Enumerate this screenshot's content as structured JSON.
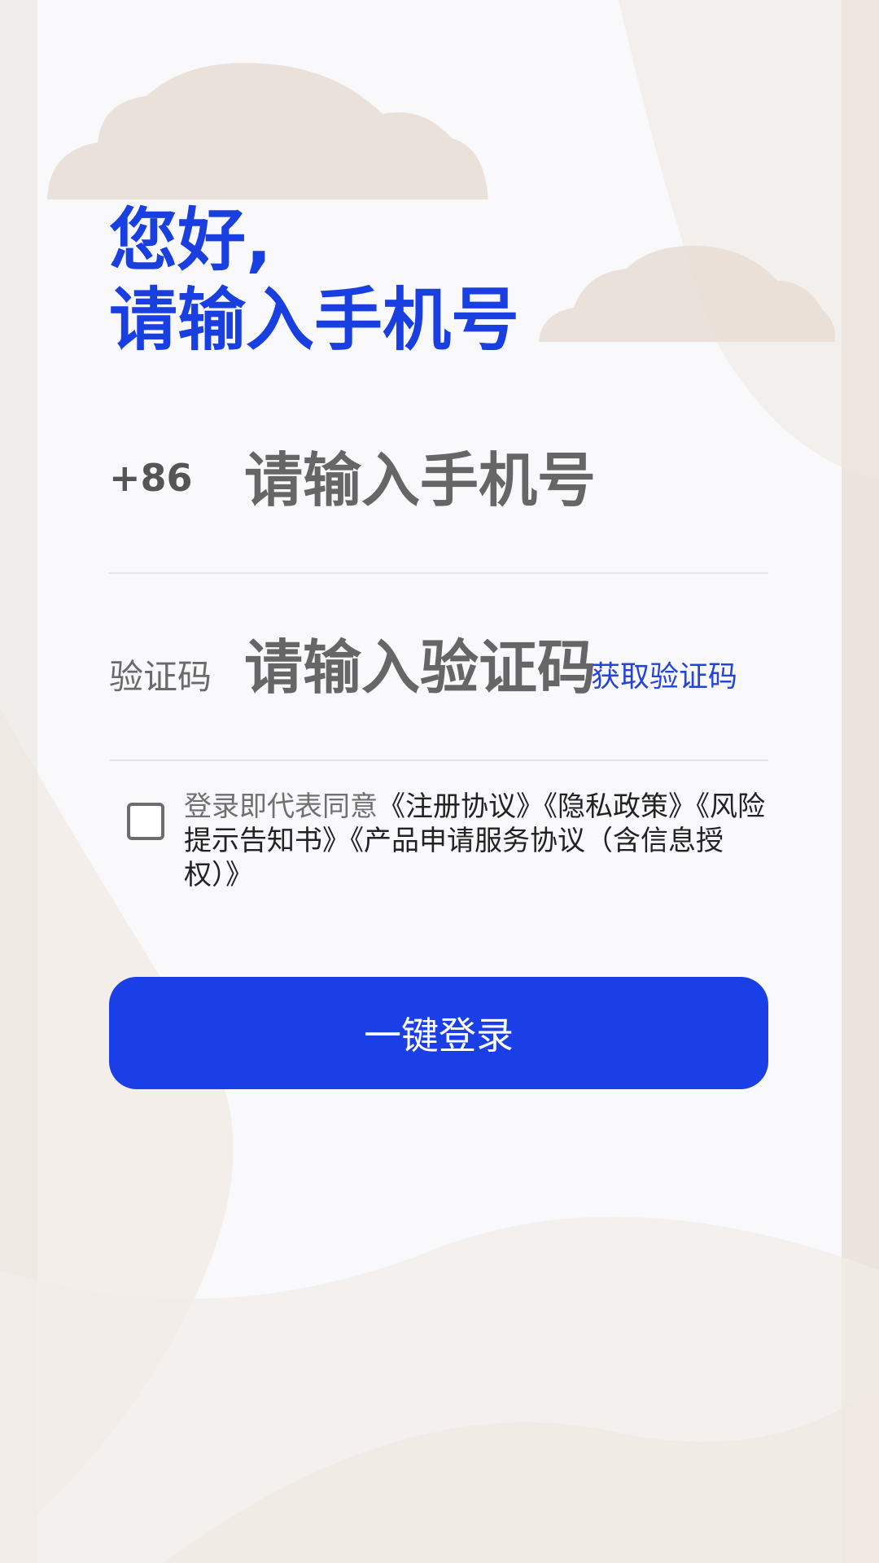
{
  "greeting": {
    "line1": "您好,",
    "line2": "请输入手机号"
  },
  "phone": {
    "prefix": "+86",
    "placeholder": "请输入手机号"
  },
  "code": {
    "label": "验证码",
    "placeholder": "请输入验证码",
    "get_code_label": "获取验证码"
  },
  "agreement": {
    "checked": false,
    "prefix": "登录即代表同意",
    "links": [
      "《注册协议》",
      "《隐私政策》",
      "《风险提示告知书》",
      "《产品申请服务协议（含信息授权）》"
    ]
  },
  "login_button": "一键登录",
  "colors": {
    "accent": "#1a3fe6",
    "title": "#1a3fe0",
    "link": "#2445d8"
  },
  "icons": [
    "cloud-icon",
    "checkbox-icon"
  ]
}
